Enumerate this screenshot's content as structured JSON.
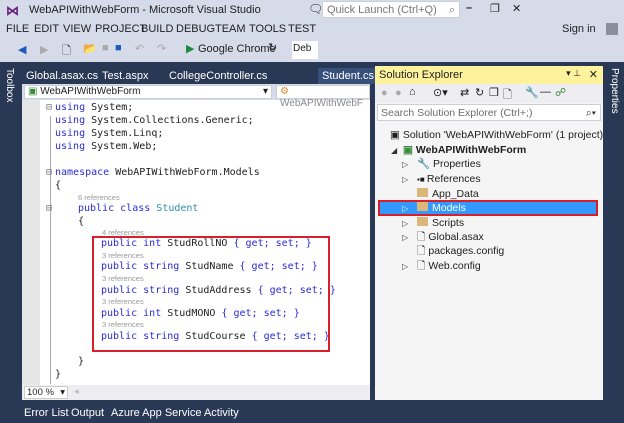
{
  "window": {
    "title": "WebAPIWithWebForm - Microsoft Visual Studio",
    "quick_launch_placeholder": "Quick Launch (Ctrl+Q)",
    "sign_in": "Sign in"
  },
  "menu": [
    "FILE",
    "EDIT",
    "VIEW",
    "PROJECT",
    "BUILD",
    "DEBUG",
    "TEAM",
    "TOOLS",
    "TEST"
  ],
  "toolbar": {
    "run_target": "Google Chrome",
    "config": "Deb"
  },
  "side": {
    "toolbox": "Toolbox",
    "properties": "Properties"
  },
  "tabs": [
    "Global.asax.cs",
    "Test.aspx",
    "CollegeController.cs",
    "Student.cs"
  ],
  "editor": {
    "project_combo": "WebAPIWithWebForm",
    "class_combo": "WebAPIWithWebF",
    "zoom": "100 %",
    "refs": {
      "class": "6 references",
      "p1": "4 references",
      "p2": "3 references",
      "p3": "3 references",
      "p4": "3 references",
      "p5": "3 references"
    },
    "lines": {
      "u1": "System;",
      "u2": "System.Collections.Generic;",
      "u3": "System.Linq;",
      "u4": "System.Web;",
      "ns": "WebAPIWithWebForm.Models",
      "cls": "Student",
      "p1": "StudRollNO",
      "p2": "StudName",
      "p3": "StudAddress",
      "p4": "StudMONO",
      "p5": "StudCourse"
    },
    "kw": {
      "using": "using",
      "namespace": "namespace",
      "public": "public",
      "class": "class",
      "int": "int",
      "string": "string",
      "getset": "{ get; set; }"
    }
  },
  "solution_explorer": {
    "title": "Solution Explorer",
    "search_placeholder": "Search Solution Explorer (Ctrl+;)",
    "solution": "Solution 'WebAPIWithWebForm' (1 project)",
    "project": "WebAPIWithWebForm",
    "items": [
      "Properties",
      "References",
      "App_Data",
      "Models",
      "Scripts",
      "Global.asax",
      "packages.config",
      "Web.config"
    ]
  },
  "bottom_tabs": [
    "Error List",
    "Output",
    "Azure App Service Activity"
  ],
  "colors": {
    "accent": "#3399ff",
    "highlight": "#d9202a",
    "header": "#fff29d"
  }
}
